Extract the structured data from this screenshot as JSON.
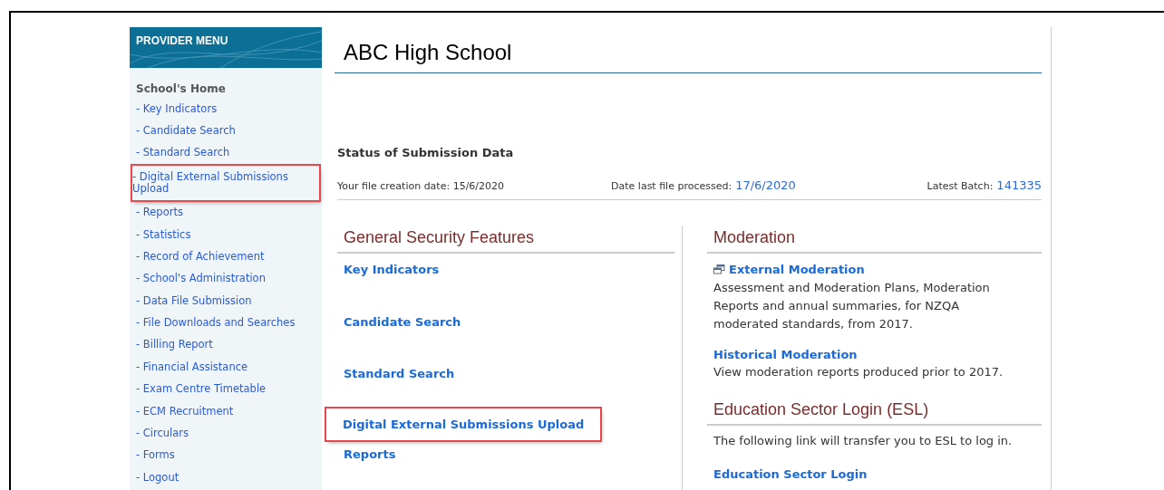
{
  "sidebar": {
    "title": "PROVIDER MENU",
    "heading": "School's Home",
    "items": [
      {
        "label": "- Key Indicators",
        "highlighted": false
      },
      {
        "label": "- Candidate Search",
        "highlighted": false
      },
      {
        "label": "- Standard Search",
        "highlighted": false
      },
      {
        "label": "- Digital External Submissions Upload",
        "highlighted": true
      },
      {
        "label": "- Reports",
        "highlighted": false
      },
      {
        "label": "- Statistics",
        "highlighted": false
      },
      {
        "label": "- Record of Achievement",
        "highlighted": false
      },
      {
        "label": "- School's Administration",
        "highlighted": false
      },
      {
        "label": "- Data File Submission",
        "highlighted": false
      },
      {
        "label": "- File Downloads and Searches",
        "highlighted": false
      },
      {
        "label": "- Billing Report",
        "highlighted": false
      },
      {
        "label": "- Financial Assistance",
        "highlighted": false
      },
      {
        "label": "- Exam Centre Timetable",
        "highlighted": false
      },
      {
        "label": "- ECM Recruitment",
        "highlighted": false
      },
      {
        "label": "- Circulars",
        "highlighted": false
      },
      {
        "label": "- Forms",
        "highlighted": false
      },
      {
        "label": "- Logout",
        "highlighted": false
      }
    ]
  },
  "page_title": "ABC High School",
  "status": {
    "title": "Status of Submission Data",
    "creation_label": "Your file creation date: 15/6/2020",
    "processed_label": "Date last file processed:",
    "processed_value": "17/6/2020",
    "batch_label": "Latest Batch:",
    "batch_value": "141335"
  },
  "security": {
    "title": "General Security Features",
    "links": [
      {
        "label": "Key Indicators",
        "highlighted": false
      },
      {
        "label": "Candidate Search",
        "highlighted": false
      },
      {
        "label": "Standard Search",
        "highlighted": false
      },
      {
        "label": "Digital External Submissions Upload",
        "highlighted": true
      },
      {
        "label": "Reports",
        "highlighted": false
      }
    ]
  },
  "moderation": {
    "title": "Moderation",
    "entries": [
      {
        "link": "External Moderation",
        "new_window": true,
        "text": "Assessment and Moderation Plans, Moderation Reports and annual summaries, for NZQA moderated standards, from 2017."
      },
      {
        "link": "Historical Moderation",
        "new_window": false,
        "text": "View moderation reports produced prior to 2017."
      }
    ]
  },
  "esl": {
    "title": "Education Sector Login (ESL)",
    "text": "The following link will transfer you to ESL to log in.",
    "link": "Education Sector Login"
  }
}
